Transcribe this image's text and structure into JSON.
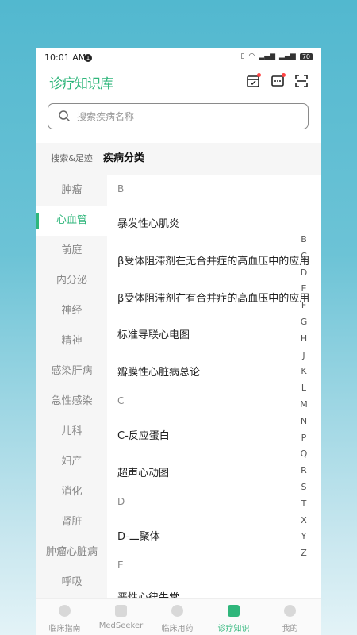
{
  "status": {
    "time": "10:01 AM",
    "notif_count": "1",
    "battery": "70"
  },
  "header": {
    "logo": "诊疗知识库"
  },
  "search": {
    "placeholder": "搜索疾病名称"
  },
  "sidebar": {
    "header": "搜索&足迹",
    "items": [
      "肿瘤",
      "心血管",
      "前庭",
      "内分泌",
      "神经",
      "精神",
      "感染肝病",
      "急性感染",
      "儿科",
      "妇产",
      "消化",
      "肾脏",
      "肿瘤心脏病",
      "呼吸"
    ],
    "active": "心血管"
  },
  "content": {
    "title": "疾病分类",
    "sections": [
      {
        "letter": "B",
        "items": [
          "暴发性心肌炎",
          "β受体阻滞剂在无合并症的高血压中的应用",
          "β受体阻滞剂在有合并症的高血压中的应用",
          "标准导联心电图",
          "瓣膜性心脏病总论"
        ]
      },
      {
        "letter": "C",
        "items": [
          "C-反应蛋白",
          "超声心动图"
        ]
      },
      {
        "letter": "D",
        "items": [
          "D-二聚体"
        ]
      },
      {
        "letter": "E",
        "items": [
          "恶性心律失常"
        ]
      }
    ]
  },
  "alphabet": [
    "B",
    "C",
    "D",
    "E",
    "F",
    "G",
    "H",
    "J",
    "K",
    "L",
    "M",
    "N",
    "P",
    "Q",
    "R",
    "S",
    "T",
    "X",
    "Y",
    "Z"
  ],
  "tabs": [
    {
      "label": "临床指南",
      "icon": "guide-icon"
    },
    {
      "label": "MedSeeker",
      "icon": "ai-icon"
    },
    {
      "label": "临床用药",
      "icon": "pill-icon"
    },
    {
      "label": "诊疗知识",
      "icon": "knowledge-icon"
    },
    {
      "label": "我的",
      "icon": "profile-icon"
    }
  ],
  "active_tab": "诊疗知识",
  "colors": {
    "accent": "#2fb67b",
    "badge": "#ff4444"
  }
}
